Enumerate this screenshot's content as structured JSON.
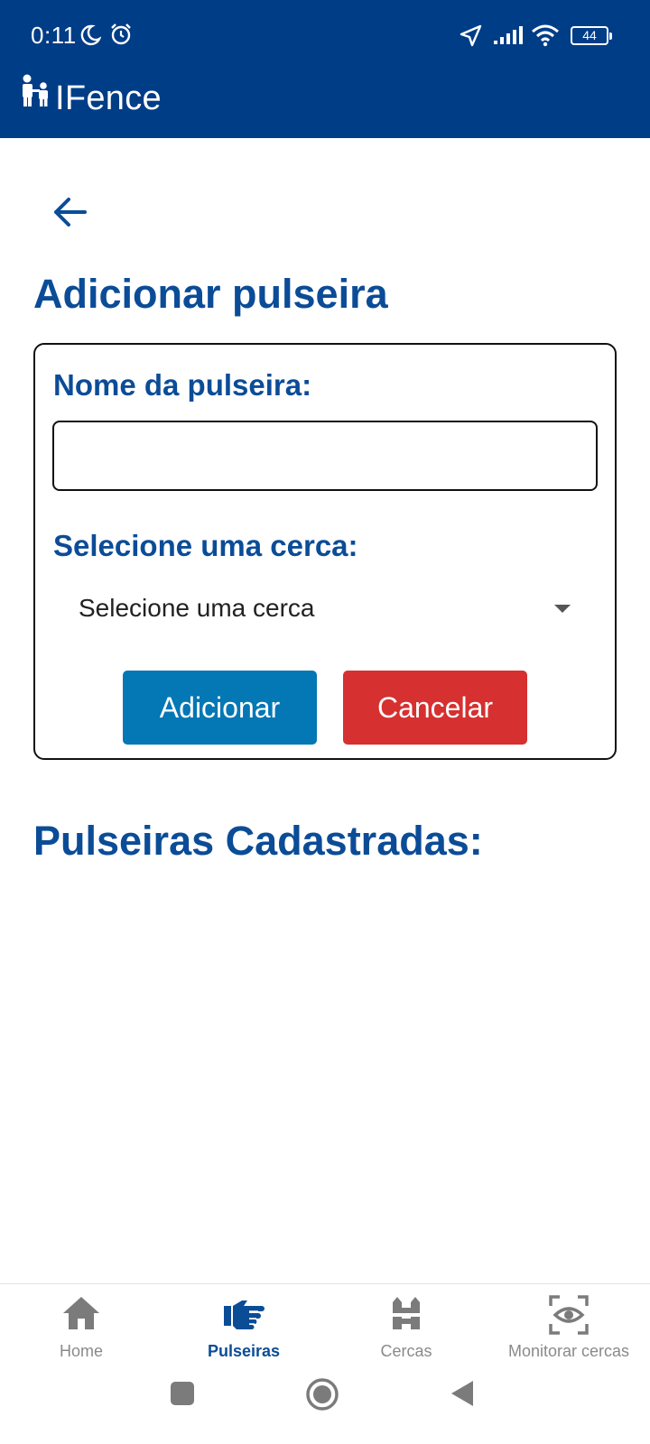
{
  "status_bar": {
    "time": "0:11",
    "battery": "44"
  },
  "app": {
    "title": "IFence"
  },
  "page": {
    "title": "Adicionar pulseira"
  },
  "form": {
    "name_label": "Nome da pulseira:",
    "name_value": "",
    "fence_label": "Selecione uma cerca:",
    "fence_selected": "Selecione uma cerca",
    "add_button": "Adicionar",
    "cancel_button": "Cancelar"
  },
  "list": {
    "title": "Pulseiras Cadastradas:"
  },
  "bottom_nav": {
    "items": [
      {
        "label": "Home",
        "icon": "home-icon",
        "active": false
      },
      {
        "label": "Pulseiras",
        "icon": "hand-pointing-icon",
        "active": true
      },
      {
        "label": "Cercas",
        "icon": "fence-icon",
        "active": false
      },
      {
        "label": "Monitorar cercas",
        "icon": "eye-scan-icon",
        "active": false
      }
    ]
  },
  "colors": {
    "app_bar": "#003d87",
    "heading": "#0b4c97",
    "add_button": "#0477b5",
    "cancel_button": "#d63030",
    "nav_inactive": "#8a8a8a"
  }
}
